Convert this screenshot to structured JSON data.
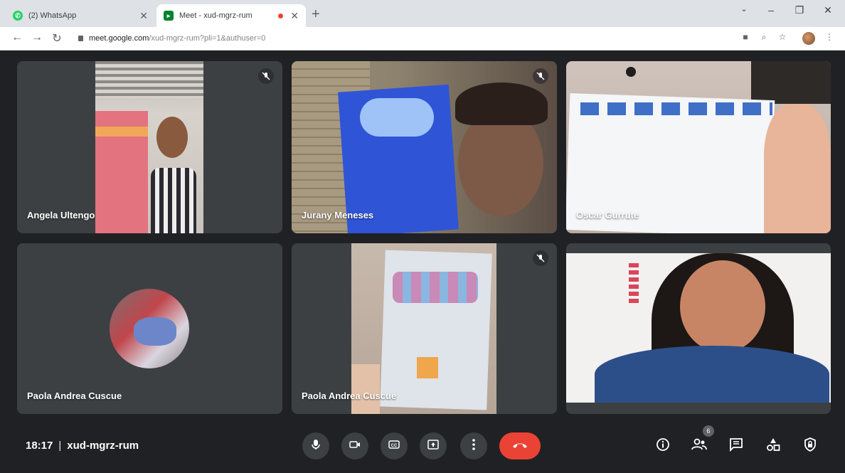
{
  "browser": {
    "tabs": [
      {
        "title": "(2) WhatsApp",
        "active": false
      },
      {
        "title": "Meet - xud-mgrz-rum",
        "active": true
      }
    ],
    "url_host": "meet.google.com",
    "url_path": "/xud-mgrz-rum?pli=1&authuser=0"
  },
  "participants": [
    {
      "name": "Angela Ultengo",
      "muted": true
    },
    {
      "name": "Jurany Meneses",
      "muted": true
    },
    {
      "name": "Oscar Gurrute",
      "muted": false
    },
    {
      "name": "Paola Andrea Cuscue",
      "muted": false
    },
    {
      "name": "Paola Andrea Cuscue",
      "muted": true
    },
    {
      "name": "",
      "muted": false
    }
  ],
  "meeting": {
    "time": "18:17",
    "separator": "|",
    "code": "xud-mgrz-rum",
    "people_count": "6"
  },
  "colors": {
    "background": "#202124",
    "tile": "#3c4043",
    "hangup": "#ea4335"
  },
  "icons": [
    "mic-icon",
    "camera-icon",
    "captions-icon",
    "present-icon",
    "more-icon",
    "hangup-icon",
    "info-icon",
    "people-icon",
    "chat-icon",
    "activities-icon",
    "host-controls-icon"
  ]
}
